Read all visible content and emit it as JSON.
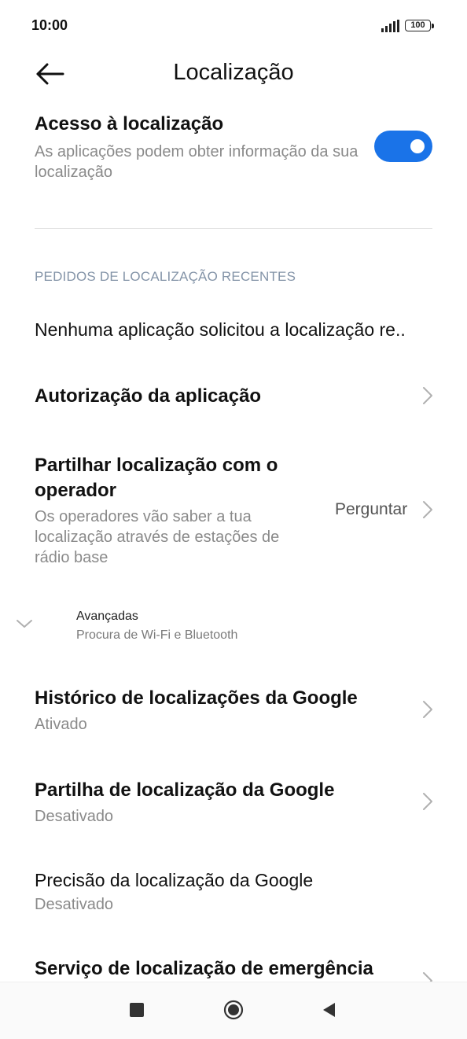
{
  "status_bar": {
    "time": "10:00",
    "battery": "100"
  },
  "header": {
    "title": "Localização"
  },
  "location_access": {
    "title": "Acesso à localização",
    "subtitle": "As aplicações podem obter informação da sua localização",
    "enabled": true
  },
  "recent_requests": {
    "section_title": "PEDIDOS DE LOCALIZAÇÃO RECENTES",
    "empty_text": "Nenhuma aplicação solicitou a localização re.."
  },
  "app_authorization": {
    "title": "Autorização da aplicação"
  },
  "operator_sharing": {
    "title": "Partilhar localização com o operador",
    "subtitle": "Os operadores vão saber a tua localização através de estações de rádio base",
    "value": "Perguntar"
  },
  "advanced": {
    "title": "Avançadas",
    "subtitle": "Procura de Wi-Fi e Bluetooth"
  },
  "google_history": {
    "title": "Histórico de localizações da Google",
    "status": "Ativado"
  },
  "google_sharing": {
    "title": "Partilha de localização da Google",
    "status": "Desativado"
  },
  "google_accuracy": {
    "title": "Precisão da localização da Google",
    "status": "Desativado"
  },
  "emergency_service": {
    "title": "Serviço de localização de emergência"
  },
  "icons": {
    "back": "arrow-left-icon",
    "chevron": "chevron-right-icon",
    "expand": "chevron-down-icon",
    "nav_recents": "square-icon",
    "nav_home": "circle-icon",
    "nav_back": "triangle-left-icon"
  },
  "colors": {
    "accent": "#1a73e8",
    "section_header": "#8494a8",
    "subtitle": "#8a8a8a"
  }
}
